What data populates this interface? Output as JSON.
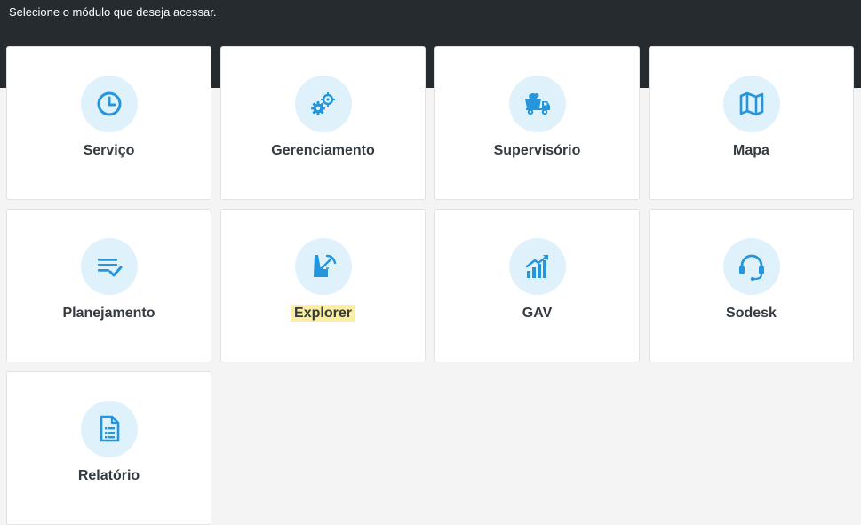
{
  "header": {
    "instruction": "Selecione o módulo que deseja acessar."
  },
  "colors": {
    "header_bg": "#252b2e",
    "page_bg": "#f4f4f4",
    "icon_blue": "#2596dc",
    "icon_circle": "#dff2fb",
    "highlight": "#fbeea2"
  },
  "modules": [
    {
      "label": "Serviço",
      "icon": "clock-icon"
    },
    {
      "label": "Gerenciamento",
      "icon": "gears-icon"
    },
    {
      "label": "Supervisório",
      "icon": "dump-truck-icon"
    },
    {
      "label": "Mapa",
      "icon": "map-icon"
    },
    {
      "label": "Planejamento",
      "icon": "checklist-icon"
    },
    {
      "label": "Explorer",
      "icon": "miner-pickaxe-icon",
      "highlighted": true
    },
    {
      "label": "GAV",
      "icon": "growth-chart-icon"
    },
    {
      "label": "Sodesk",
      "icon": "headset-icon"
    },
    {
      "label": "Relatório",
      "icon": "document-icon"
    }
  ]
}
